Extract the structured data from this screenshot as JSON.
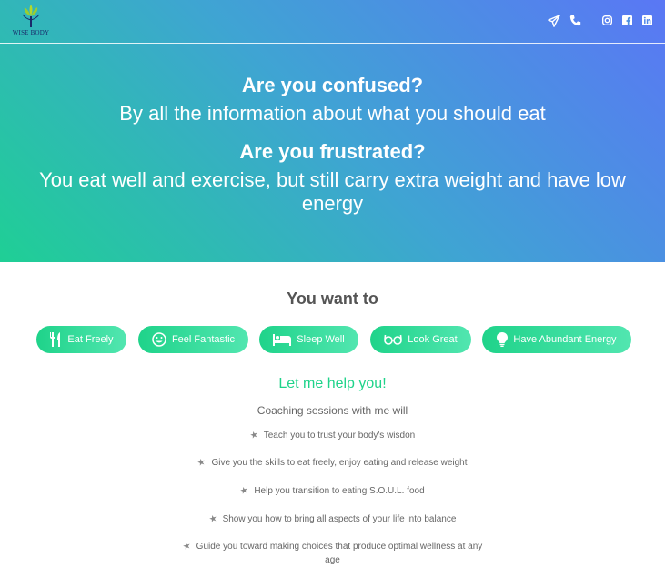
{
  "brand": {
    "name": "WISE BODY"
  },
  "nav": {
    "icons": [
      "paper-plane-icon",
      "phone-icon",
      "instagram-icon",
      "facebook-icon",
      "linkedin-icon"
    ]
  },
  "hero": {
    "q1_bold": "Are you confused?",
    "q1_text": "By all the information about what you should eat",
    "q2_bold": "Are you frustrated?",
    "q2_text": "You eat well and exercise, but still carry extra weight and have low energy"
  },
  "want": {
    "title": "You want to",
    "pills": [
      {
        "label": "Eat Freely",
        "icon": "utensils-icon"
      },
      {
        "label": "Feel Fantastic",
        "icon": "smile-icon"
      },
      {
        "label": "Sleep Well",
        "icon": "bed-icon"
      },
      {
        "label": "Look Great",
        "icon": "glasses-icon"
      },
      {
        "label": "Have Abundant Energy",
        "icon": "lightbulb-icon"
      }
    ]
  },
  "help": {
    "title": "Let me help you!",
    "subtitle": "Coaching sessions with me will",
    "items": [
      "Teach you to trust your body's wisdon",
      "Give you the skills to eat freely, enjoy eating and release weight",
      "Help you transition to eating S.O.U.L. food",
      "Show you how to bring all aspects of your life into balance",
      "Guide you toward making choices that produce optimal wellness at any age"
    ]
  },
  "colors": {
    "accent": "#1fd38a",
    "gradient_start": "#1fcf95",
    "gradient_end": "#5a77f5",
    "text_gray": "#666666"
  }
}
